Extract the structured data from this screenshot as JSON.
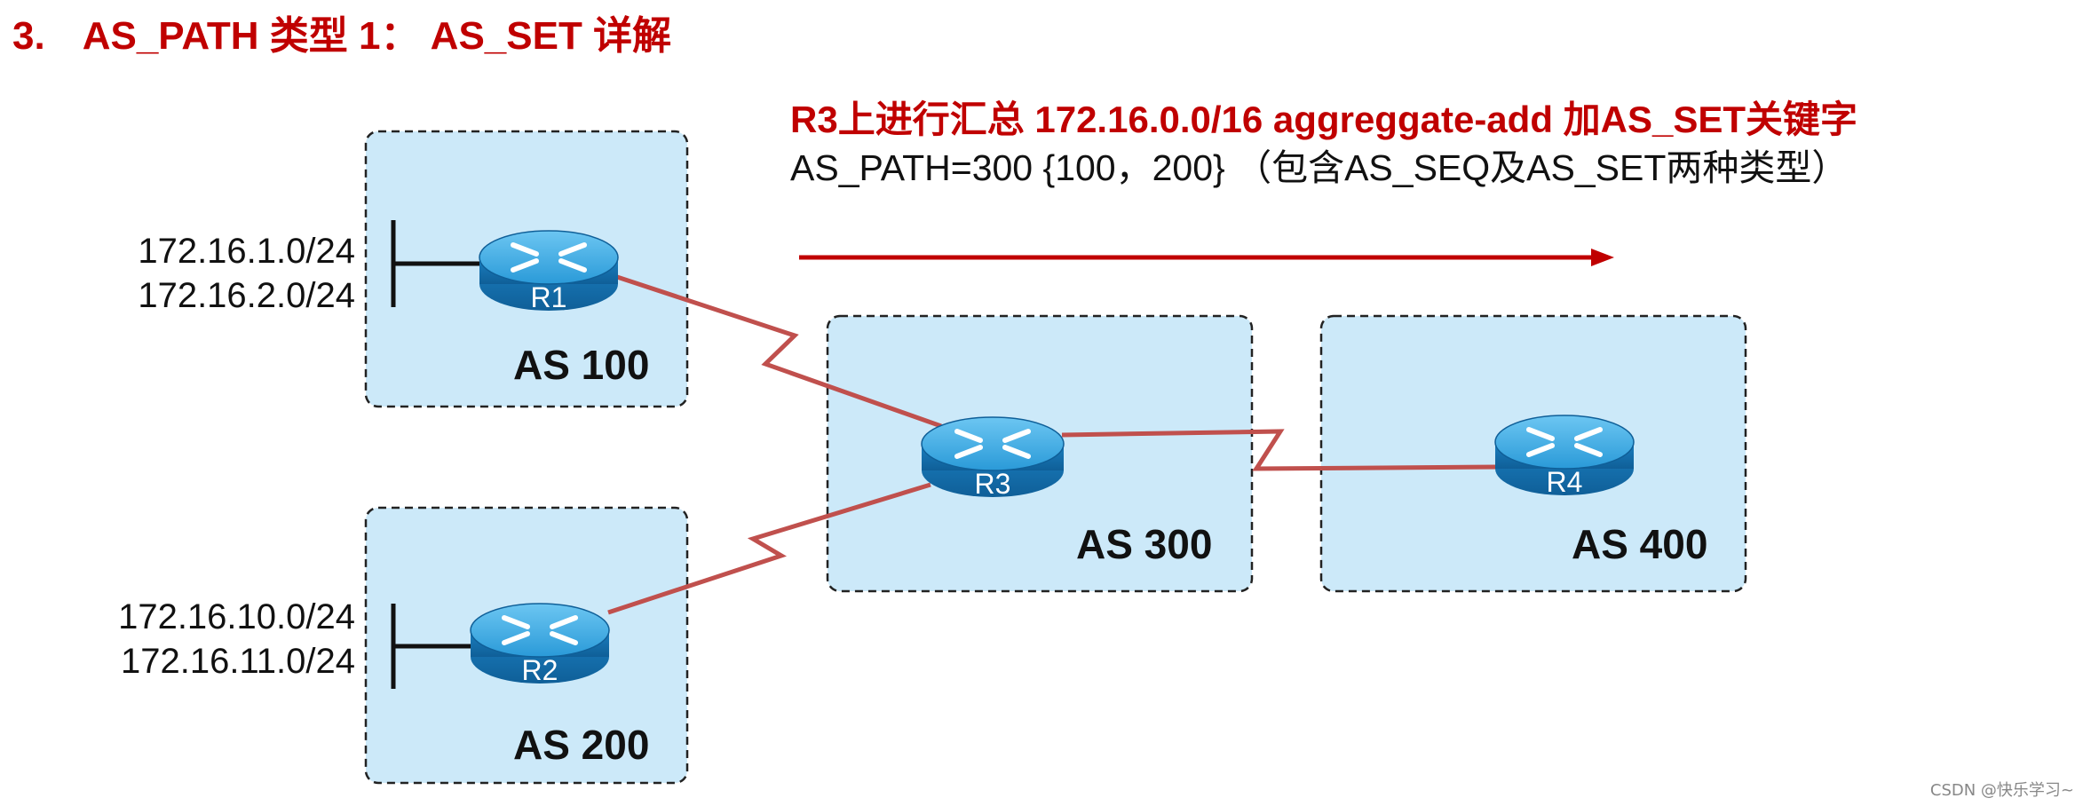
{
  "title": {
    "number": "3.",
    "text": "AS_PATH 类型 1： AS_SET 详解"
  },
  "note": {
    "line1": "R3上进行汇总 172.16.0.0/16 aggreggate-add 加AS_SET关键字",
    "line2": "AS_PATH=300 {100，200} （包含AS_SEQ及AS_SET两种类型）"
  },
  "as_boxes": [
    {
      "id": "as100",
      "label": "AS 100"
    },
    {
      "id": "as200",
      "label": "AS 200"
    },
    {
      "id": "as300",
      "label": "AS 300"
    },
    {
      "id": "as400",
      "label": "AS 400"
    }
  ],
  "routers": [
    {
      "id": "r1",
      "label": "R1"
    },
    {
      "id": "r2",
      "label": "R2"
    },
    {
      "id": "r3",
      "label": "R3"
    },
    {
      "id": "r4",
      "label": "R4"
    }
  ],
  "networks": {
    "r1": [
      "172.16.1.0/24",
      "172.16.2.0/24"
    ],
    "r2": [
      "172.16.10.0/24",
      "172.16.11.0/24"
    ]
  },
  "colors": {
    "title": "#c00000",
    "arrow": "#c00000",
    "link": "#c0504d",
    "box_fill": "#cce9f9",
    "router": "#1a8ccf"
  },
  "icons": {
    "router": "router-icon",
    "arrow": "arrow-right-icon"
  },
  "watermark": "CSDN @快乐学习~"
}
